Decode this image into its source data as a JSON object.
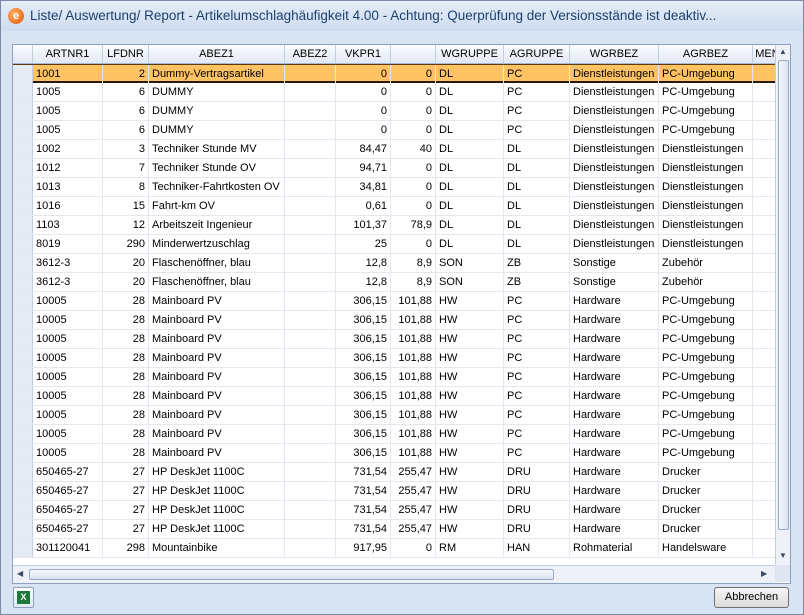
{
  "window": {
    "title": "Liste/ Auswertung/ Report - Artikelumschlaghäufigkeit 4.00 - Achtung: Querprüfung der Versionsstände ist deaktiv...",
    "icon": "app-logo-icon"
  },
  "grid": {
    "columns": [
      "ARTNR1",
      "LFDNR",
      "ABEZ1",
      "ABEZ2",
      "VKPR1",
      "",
      "WGRUPPE",
      "AGRUPPE",
      "WGRBEZ",
      "AGRBEZ",
      "MEN"
    ],
    "rows": [
      [
        "1001",
        "2",
        "Dummy-Vertragsartikel",
        "",
        "0",
        "0",
        "DL",
        "PC",
        "Dienstleistungen",
        "PC-Umgebung"
      ],
      [
        "1005",
        "6",
        "DUMMY",
        "",
        "0",
        "0",
        "DL",
        "PC",
        "Dienstleistungen",
        "PC-Umgebung"
      ],
      [
        "1005",
        "6",
        "DUMMY",
        "",
        "0",
        "0",
        "DL",
        "PC",
        "Dienstleistungen",
        "PC-Umgebung"
      ],
      [
        "1005",
        "6",
        "DUMMY",
        "",
        "0",
        "0",
        "DL",
        "PC",
        "Dienstleistungen",
        "PC-Umgebung"
      ],
      [
        "1002",
        "3",
        "Techniker Stunde MV",
        "",
        "84,47",
        "40",
        "DL",
        "DL",
        "Dienstleistungen",
        "Dienstleistungen"
      ],
      [
        "1012",
        "7",
        "Techniker Stunde OV",
        "",
        "94,71",
        "0",
        "DL",
        "DL",
        "Dienstleistungen",
        "Dienstleistungen"
      ],
      [
        "1013",
        "8",
        "Techniker-Fahrtkosten OV",
        "",
        "34,81",
        "0",
        "DL",
        "DL",
        "Dienstleistungen",
        "Dienstleistungen"
      ],
      [
        "1016",
        "15",
        "Fahrt-km OV",
        "",
        "0,61",
        "0",
        "DL",
        "DL",
        "Dienstleistungen",
        "Dienstleistungen"
      ],
      [
        "1103",
        "12",
        "Arbeitszeit Ingenieur",
        "",
        "101,37",
        "78,9",
        "DL",
        "DL",
        "Dienstleistungen",
        "Dienstleistungen"
      ],
      [
        "8019",
        "290",
        "Minderwertzuschlag",
        "",
        "25",
        "0",
        "DL",
        "DL",
        "Dienstleistungen",
        "Dienstleistungen"
      ],
      [
        "3612-3",
        "20",
        "Flaschenöffner, blau",
        "",
        "12,8",
        "8,9",
        "SON",
        "ZB",
        "Sonstige",
        "Zubehör"
      ],
      [
        "3612-3",
        "20",
        "Flaschenöffner, blau",
        "",
        "12,8",
        "8,9",
        "SON",
        "ZB",
        "Sonstige",
        "Zubehör"
      ],
      [
        "10005",
        "28",
        "Mainboard PV",
        "",
        "306,15",
        "101,88",
        "HW",
        "PC",
        "Hardware",
        "PC-Umgebung"
      ],
      [
        "10005",
        "28",
        "Mainboard PV",
        "",
        "306,15",
        "101,88",
        "HW",
        "PC",
        "Hardware",
        "PC-Umgebung"
      ],
      [
        "10005",
        "28",
        "Mainboard PV",
        "",
        "306,15",
        "101,88",
        "HW",
        "PC",
        "Hardware",
        "PC-Umgebung"
      ],
      [
        "10005",
        "28",
        "Mainboard PV",
        "",
        "306,15",
        "101,88",
        "HW",
        "PC",
        "Hardware",
        "PC-Umgebung"
      ],
      [
        "10005",
        "28",
        "Mainboard PV",
        "",
        "306,15",
        "101,88",
        "HW",
        "PC",
        "Hardware",
        "PC-Umgebung"
      ],
      [
        "10005",
        "28",
        "Mainboard PV",
        "",
        "306,15",
        "101,88",
        "HW",
        "PC",
        "Hardware",
        "PC-Umgebung"
      ],
      [
        "10005",
        "28",
        "Mainboard PV",
        "",
        "306,15",
        "101,88",
        "HW",
        "PC",
        "Hardware",
        "PC-Umgebung"
      ],
      [
        "10005",
        "28",
        "Mainboard PV",
        "",
        "306,15",
        "101,88",
        "HW",
        "PC",
        "Hardware",
        "PC-Umgebung"
      ],
      [
        "10005",
        "28",
        "Mainboard PV",
        "",
        "306,15",
        "101,88",
        "HW",
        "PC",
        "Hardware",
        "PC-Umgebung"
      ],
      [
        "650465-27",
        "27",
        "HP DeskJet 1100C",
        "",
        "731,54",
        "255,47",
        "HW",
        "DRU",
        "Hardware",
        "Drucker"
      ],
      [
        "650465-27",
        "27",
        "HP DeskJet 1100C",
        "",
        "731,54",
        "255,47",
        "HW",
        "DRU",
        "Hardware",
        "Drucker"
      ],
      [
        "650465-27",
        "27",
        "HP DeskJet 1100C",
        "",
        "731,54",
        "255,47",
        "HW",
        "DRU",
        "Hardware",
        "Drucker"
      ],
      [
        "650465-27",
        "27",
        "HP DeskJet 1100C",
        "",
        "731,54",
        "255,47",
        "HW",
        "DRU",
        "Hardware",
        "Drucker"
      ],
      [
        "301120041",
        "298",
        "Mountainbike",
        "",
        "917,95",
        "0",
        "RM",
        "HAN",
        "Rohmaterial",
        "Handelsware"
      ]
    ],
    "selected_row": 0
  },
  "footer": {
    "export_icon": "excel-export-icon",
    "close_label": "Abbrechen"
  }
}
